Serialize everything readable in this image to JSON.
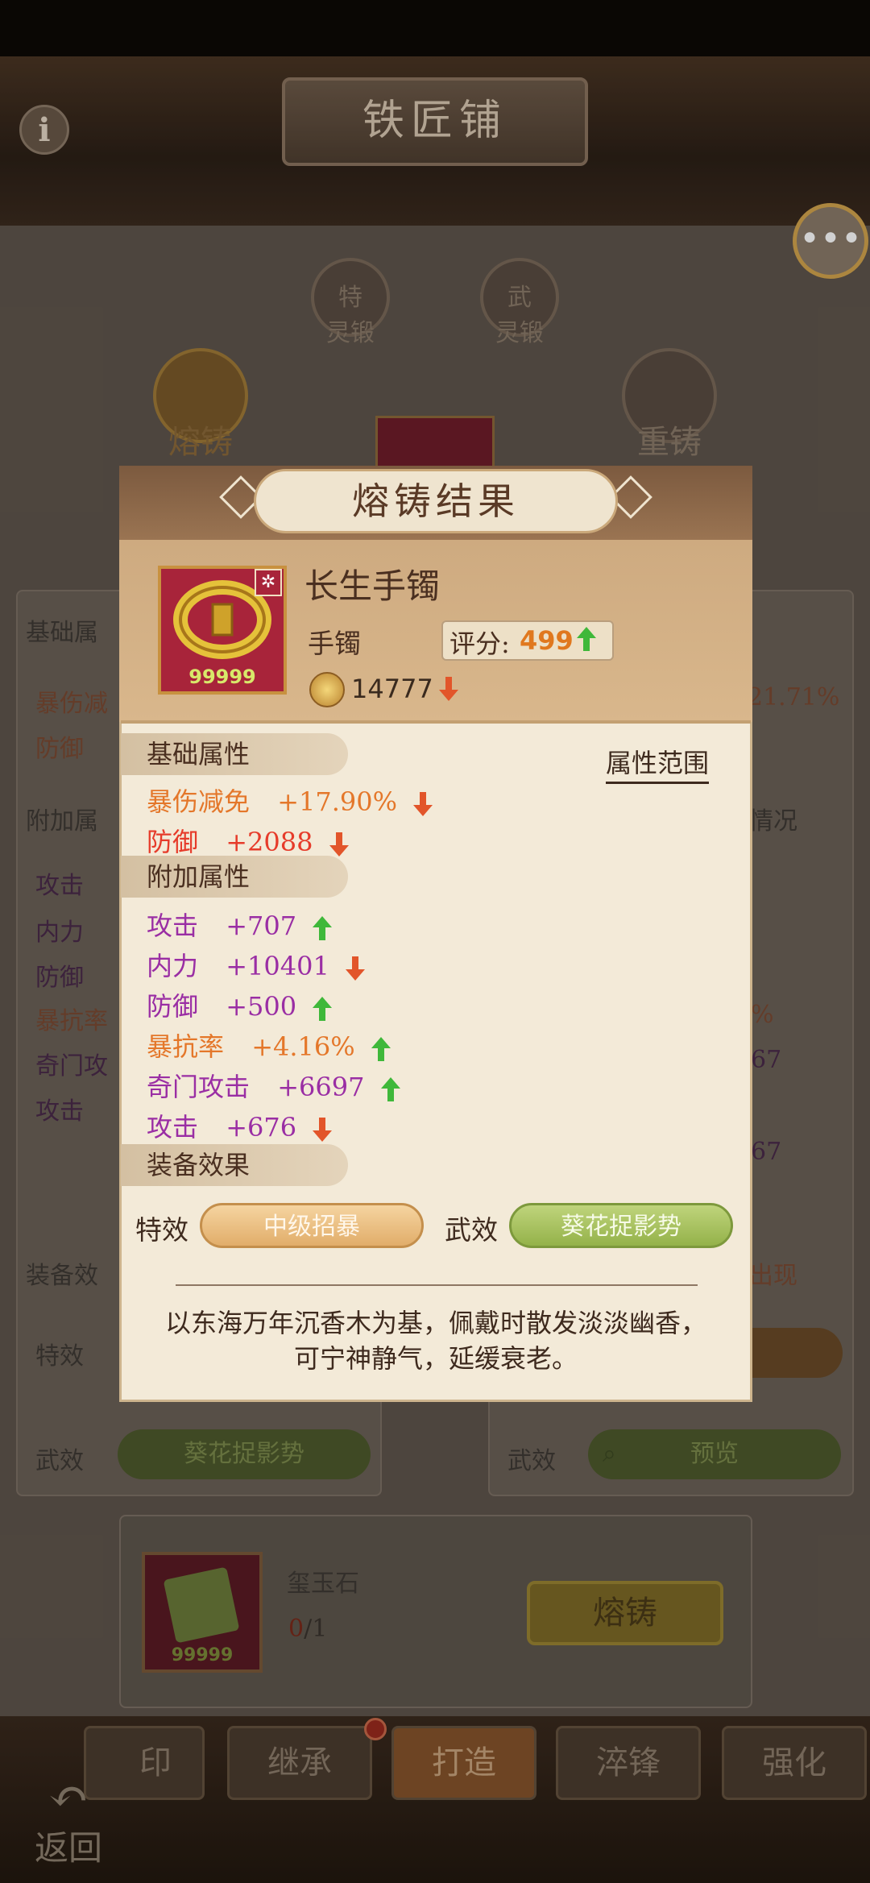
{
  "header": {
    "title": "铁匠铺"
  },
  "background": {
    "nodes": [
      "熔铸",
      "特",
      "灵锻",
      "武",
      "灵锻",
      "重铸"
    ],
    "left_panel": {
      "section_basic": "基础属",
      "basic_rows": [
        "暴伤减",
        "防御"
      ],
      "section_extra": "附加属",
      "extra_rows": [
        "攻击",
        "内力",
        "防御",
        "暴抗率",
        "奇门攻",
        "攻击"
      ],
      "section_effect": "装备效",
      "effect_te": "特效",
      "effect_wu": "武效",
      "wu_pill": "葵花捉影势"
    },
    "right_panel": {
      "value1": "21.71%",
      "label_qingkuang": "情况",
      "pct": "%",
      "n67a": "67",
      "n67b": "67",
      "chuxian": "出现",
      "effect_wu": "武效",
      "preview": "预览"
    },
    "material": {
      "name": "玺玉石",
      "have": "0",
      "need": "/1",
      "count": "99999"
    },
    "fuse_button": "熔铸"
  },
  "tabs": [
    "印",
    "继承",
    "打造",
    "淬锋",
    "强化"
  ],
  "return_label": "返回",
  "modal": {
    "title": "熔铸结果",
    "item": {
      "name": "长生手镯",
      "type": "手镯",
      "count": "99999",
      "score_label": "评分:",
      "score": "499",
      "power": "14777"
    },
    "attr_range_label": "属性范围",
    "section_basic": "基础属性",
    "section_extra": "附加属性",
    "section_effect": "装备效果",
    "basic": [
      {
        "name": "暴伤减免",
        "value": "+17.90%",
        "trend": "down"
      },
      {
        "name": "防御",
        "value": "+2088",
        "trend": "down"
      }
    ],
    "extra": [
      {
        "name": "攻击",
        "value": "+707",
        "trend": "up"
      },
      {
        "name": "内力",
        "value": "+10401",
        "trend": "down"
      },
      {
        "name": "防御",
        "value": "+500",
        "trend": "up"
      },
      {
        "name": "暴抗率",
        "value": "+4.16%",
        "trend": "up"
      },
      {
        "name": "奇门攻击",
        "value": "+6697",
        "trend": "up"
      },
      {
        "name": "攻击",
        "value": "+676",
        "trend": "down"
      }
    ],
    "effect_te_label": "特效",
    "effect_te_value": "中级招暴",
    "effect_wu_label": "武效",
    "effect_wu_value": "葵花捉影势",
    "description": "以东海万年沉香木为基，佩戴时散发淡淡幽香，可宁神静气，延缓衰老。"
  },
  "colors": {
    "up": "#3fb83a",
    "down": "#e2552a",
    "orange": "#e4772a",
    "red": "#e63b2a",
    "purple": "#9a2ea4"
  }
}
